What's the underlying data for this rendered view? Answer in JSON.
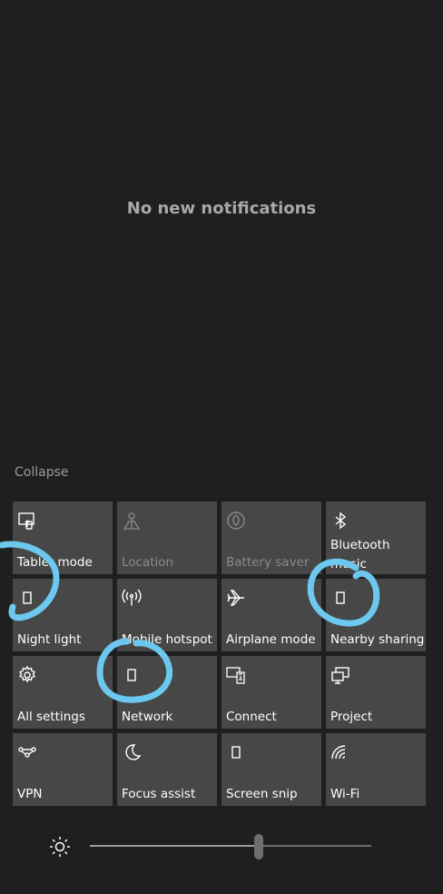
{
  "notifications": {
    "empty_text": "No new notifications"
  },
  "collapse_label": "Collapse",
  "tiles": [
    {
      "label": "Tablet mode",
      "icon": "tablet-mode-icon",
      "enabled": true
    },
    {
      "label": "Location",
      "icon": "location-icon",
      "enabled": false
    },
    {
      "label": "Battery saver",
      "icon": "battery-saver-icon",
      "enabled": false
    },
    {
      "label": "Bluetooth",
      "label_line2": "music",
      "icon": "bluetooth-icon",
      "enabled": true
    },
    {
      "label": "Night light",
      "icon": "night-light-icon",
      "enabled": true
    },
    {
      "label": "Mobile hotspot",
      "icon": "mobile-hotspot-icon",
      "enabled": true
    },
    {
      "label": "Airplane mode",
      "icon": "airplane-icon",
      "enabled": true
    },
    {
      "label": "Nearby sharing",
      "icon": "nearby-sharing-icon",
      "enabled": true
    },
    {
      "label": "All settings",
      "icon": "gear-icon",
      "enabled": true
    },
    {
      "label": "Network",
      "icon": "network-icon",
      "enabled": true
    },
    {
      "label": "Connect",
      "icon": "connect-icon",
      "enabled": true
    },
    {
      "label": "Project",
      "icon": "project-icon",
      "enabled": true
    },
    {
      "label": "VPN",
      "icon": "vpn-icon",
      "enabled": true
    },
    {
      "label": "Focus assist",
      "icon": "moon-icon",
      "enabled": true
    },
    {
      "label": "Screen snip",
      "icon": "screen-snip-icon",
      "enabled": true
    },
    {
      "label": "Wi-Fi",
      "icon": "wifi-icon",
      "enabled": true
    }
  ],
  "brightness": {
    "level": 0.6,
    "icon": "sun-icon"
  },
  "colors": {
    "background": "#1f1f1f",
    "tile": "#474747",
    "annotation": "#6cc8ee"
  }
}
